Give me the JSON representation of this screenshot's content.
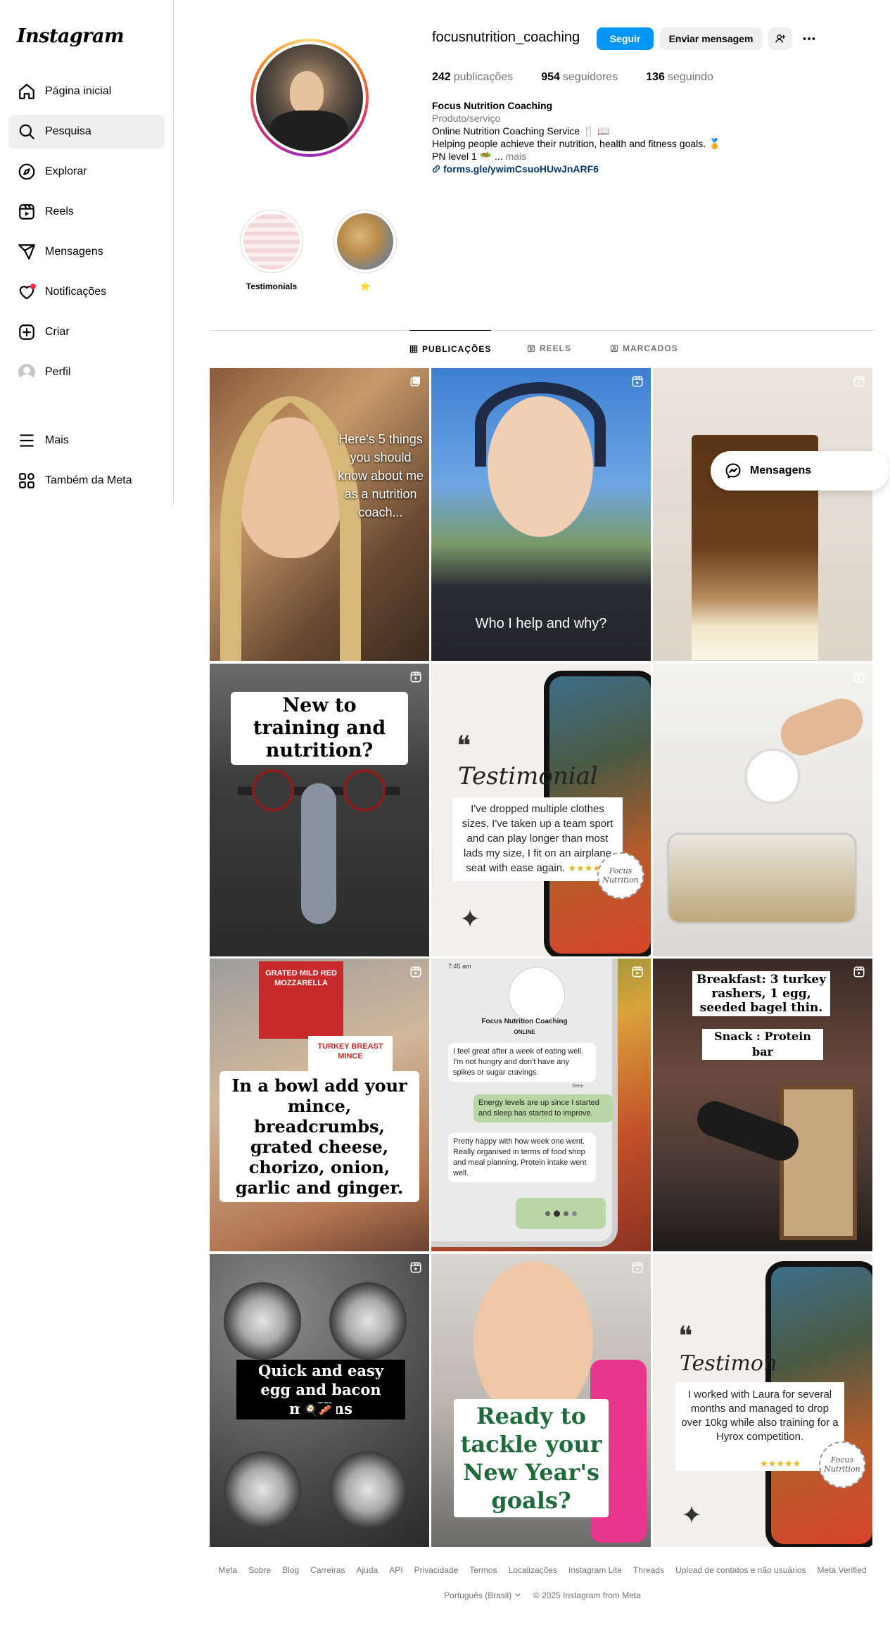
{
  "app": {
    "logo": "Instagram"
  },
  "sidebar": {
    "items": [
      {
        "label": "Página inicial",
        "icon": "home-icon"
      },
      {
        "label": "Pesquisa",
        "icon": "search-icon"
      },
      {
        "label": "Explorar",
        "icon": "compass-icon"
      },
      {
        "label": "Reels",
        "icon": "reels-icon"
      },
      {
        "label": "Mensagens",
        "icon": "send-icon"
      },
      {
        "label": "Notificações",
        "icon": "heart-icon"
      },
      {
        "label": "Criar",
        "icon": "plus-square-icon"
      },
      {
        "label": "Perfil",
        "icon": "avatar"
      }
    ],
    "bottom": [
      {
        "label": "Mais",
        "icon": "menu-icon"
      },
      {
        "label": "Também da Meta",
        "icon": "meta-apps-icon"
      }
    ],
    "active_index": 1
  },
  "profile": {
    "username": "focusnutrition_coaching",
    "follow_label": "Seguir",
    "message_label": "Enviar mensagem",
    "stats": {
      "posts": "242",
      "posts_label": "publicações",
      "followers": "954",
      "followers_label": "seguidores",
      "following": "136",
      "following_label": "seguindo"
    },
    "bio": {
      "name": "Focus Nutrition Coaching",
      "category": "Produto/serviço",
      "line1": "Online Nutrition Coaching Service 🍴 📖",
      "line2": "Helping people achieve their nutrition, health and fitness goals. 🏅",
      "line3": "PN level 1 🥗 ...",
      "more": "mais",
      "link": "forms.gle/ywimCsuoHUwJnARF6"
    }
  },
  "highlights": [
    {
      "label": "Testimonials"
    },
    {
      "label": "⭐"
    }
  ],
  "tabs": [
    {
      "label": "PUBLICAÇÕES"
    },
    {
      "label": "REELS"
    },
    {
      "label": "MARCADOS"
    }
  ],
  "posts": [
    {
      "caption": "Here's 5 things you should know about me as a nutrition coach..."
    },
    {
      "caption": "Who I help and why?"
    },
    {
      "caption": ""
    },
    {
      "caption": "New to training and nutrition?"
    },
    {
      "caption_heading": "Testimonial",
      "caption": "I've dropped multiple clothes sizes, I've taken up a team sport and can play longer than most lads my size, I fit on an airplane seat with ease again.",
      "stars": "★★★★★",
      "seal": "Focus Nutrition"
    },
    {
      "caption": ""
    },
    {
      "caption": "In a bowl add your mince, breadcrumbs, grated cheese, chorizo, onion, garlic and ginger.",
      "pkg1": "GRATED MILD RED MOZZARELLA",
      "pkg2": "TURKEY BREAST MINCE"
    },
    {
      "time": "7:45 am",
      "title": "Focus Nutrition Coaching",
      "status": "ONLINE",
      "msg1": "I feel great after a week of eating well. I'm not hungry and don't have any spikes or sugar cravings.",
      "msg2": "Energy levels are up since I started and sleep has started to improve.",
      "msg3": "Pretty happy with how week one went. Really organised in terms of food shop and meal planning. Protein intake went well.",
      "seen": "Seen"
    },
    {
      "caption": "Breakfast: 3 turkey rashers, 1 egg, seeded bagel thin.",
      "caption2": "Snack : Protein bar"
    },
    {
      "caption": "Quick and easy egg and bacon muffins",
      "emoji": "🍳🥓"
    },
    {
      "caption": "Ready to tackle your New Year's goals?"
    },
    {
      "caption_heading": "Testimon",
      "caption": "I worked with Laura for several months and managed to drop over 10kg while also training for a Hyrox competition.",
      "stars": "★★★★★",
      "seal": "Focus Nutrition"
    }
  ],
  "floating": {
    "messages_label": "Mensagens"
  },
  "footer": {
    "links": [
      "Meta",
      "Sobre",
      "Blog",
      "Carreiras",
      "Ajuda",
      "API",
      "Privacidade",
      "Termos",
      "Localizações",
      "Instagram Lite",
      "Threads",
      "Upload de contatos e não usuários",
      "Meta Verified"
    ],
    "language": "Português (Brasil)",
    "copyright": "© 2025 Instagram from Meta"
  },
  "colors": {
    "accent": "#0095f6",
    "link": "#00376b",
    "muted": "#737373",
    "border": "#dbdbdb",
    "notif": "#ff3040"
  }
}
